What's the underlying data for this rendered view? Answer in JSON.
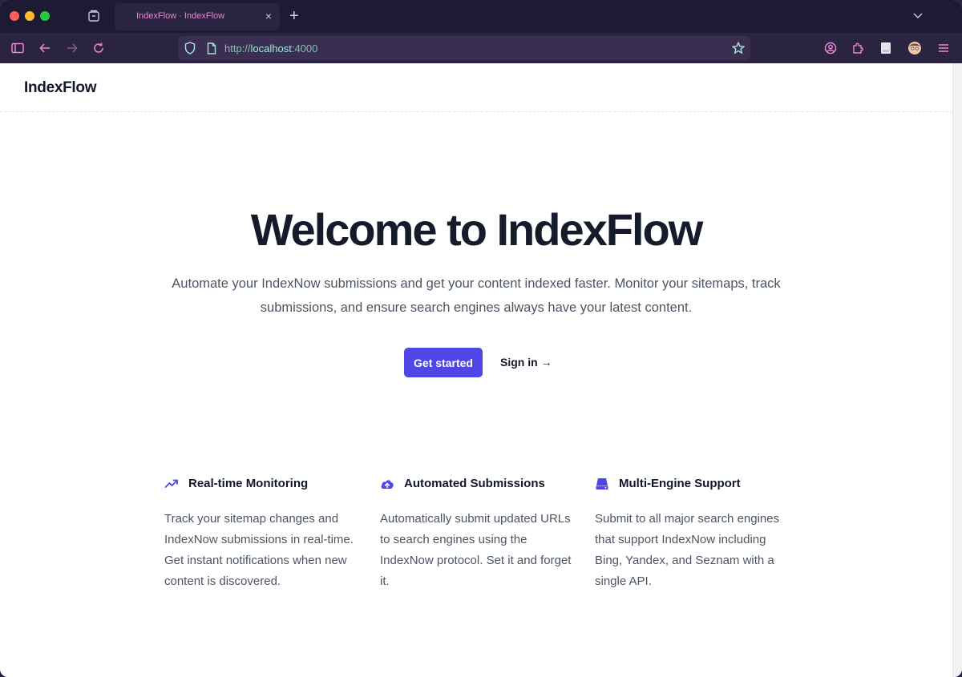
{
  "browser": {
    "tab_title": "IndexFlow · IndexFlow",
    "tab_close": "×",
    "new_tab": "+",
    "url": {
      "scheme": "http://",
      "host": "localhost",
      "port": ":4000"
    }
  },
  "header": {
    "logo": "IndexFlow"
  },
  "hero": {
    "title": "Welcome to IndexFlow",
    "description": "Automate your IndexNow submissions and get your content indexed faster. Monitor your sitemaps, track submissions, and ensure search engines always have your latest content.",
    "primary_cta": "Get started",
    "secondary_cta": "Sign in →"
  },
  "features": [
    {
      "icon": "trending-up-icon",
      "title": "Real-time Monitoring",
      "body": "Track your sitemap changes and IndexNow submissions in real-time. Get instant notifications when new content is discovered."
    },
    {
      "icon": "cloud-upload-icon",
      "title": "Automated Submissions",
      "body": "Automatically submit updated URLs to search engines using the IndexNow protocol. Set it and forget it."
    },
    {
      "icon": "server-icon",
      "title": "Multi-Engine Support",
      "body": "Submit to all major search engines that support IndexNow including Bing, Yandex, and Seznam with a single API."
    }
  ],
  "colors": {
    "accent": "#4f46e5",
    "chrome_bg": "#1c1b33",
    "toolbar_bg": "#2b2440",
    "chrome_icon": "#e986d4"
  }
}
